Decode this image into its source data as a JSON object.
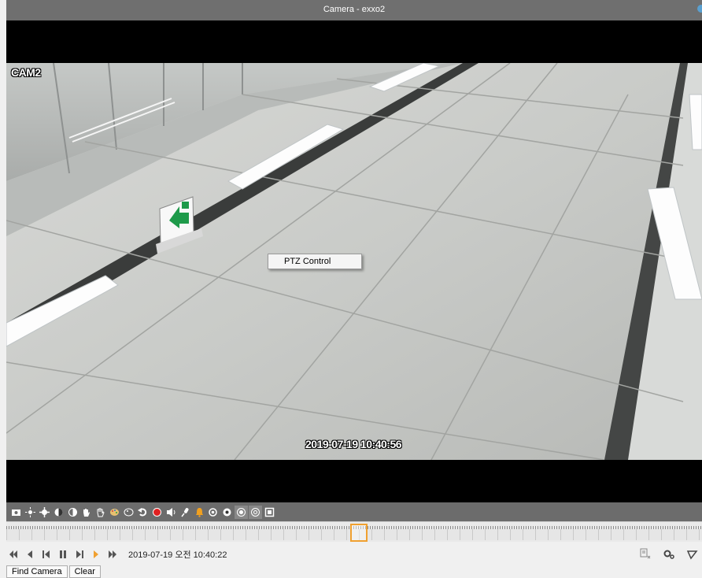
{
  "window": {
    "title": "Camera - exxo2"
  },
  "viewer": {
    "camera_label": "CAM2",
    "osd_timestamp": "2019-07-19 10:40:56",
    "context_menu": {
      "items": [
        "PTZ Control"
      ]
    }
  },
  "control_bar": {
    "buttons": [
      {
        "name": "snapshot-icon",
        "glyph": "▣"
      },
      {
        "name": "brightness-up-icon",
        "glyph": "☼"
      },
      {
        "name": "brightness-down-icon",
        "glyph": "✷"
      },
      {
        "name": "contrast-up-icon",
        "glyph": "◐"
      },
      {
        "name": "contrast-down-icon",
        "glyph": "◑"
      },
      {
        "name": "hand-icon",
        "glyph": "✋"
      },
      {
        "name": "hand-outline-icon",
        "glyph": "✋"
      },
      {
        "name": "color-icon",
        "glyph": "◉"
      },
      {
        "name": "color-outline-icon",
        "glyph": "◎"
      },
      {
        "name": "undo-icon",
        "glyph": "↺"
      },
      {
        "name": "record-icon",
        "glyph": "●"
      },
      {
        "name": "speaker-icon",
        "glyph": "◀"
      },
      {
        "name": "microphone-icon",
        "glyph": "♪"
      },
      {
        "name": "alarm-icon",
        "glyph": "⚠"
      },
      {
        "name": "focus-icon",
        "glyph": "◈"
      },
      {
        "name": "iris-icon",
        "glyph": "⊙"
      },
      {
        "name": "preset-icon",
        "glyph": "⊚"
      },
      {
        "name": "tour-icon",
        "glyph": "⊛"
      },
      {
        "name": "fullscreen-icon",
        "glyph": "▢"
      }
    ]
  },
  "playback": {
    "time": "2019-07-19 오전 10:40:22"
  },
  "buttons": {
    "find_camera": "Find Camera",
    "clear": "Clear"
  },
  "colors": {
    "record_red": "#e02020",
    "alarm_orange": "#f0a020",
    "timeline_cursor": "#f0a030",
    "play_orange": "#f0a030"
  }
}
